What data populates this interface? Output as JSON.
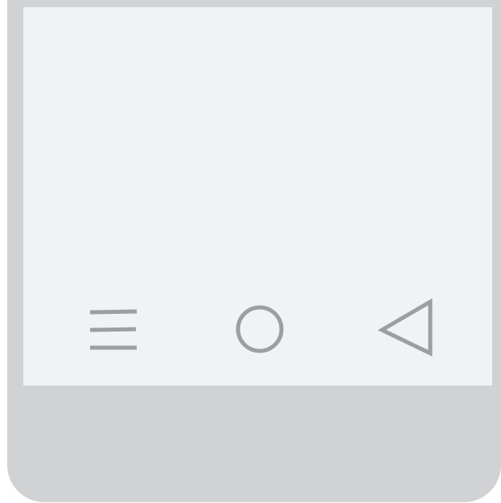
{
  "device": {
    "bezel_color": "#d1d2d4",
    "screen_color": "#f1f2f4",
    "icon_color": "#9c9ea1"
  },
  "navigation_bar": {
    "buttons": [
      {
        "icon": "menu-icon"
      },
      {
        "icon": "home-circle-icon"
      },
      {
        "icon": "back-triangle-icon"
      }
    ]
  }
}
